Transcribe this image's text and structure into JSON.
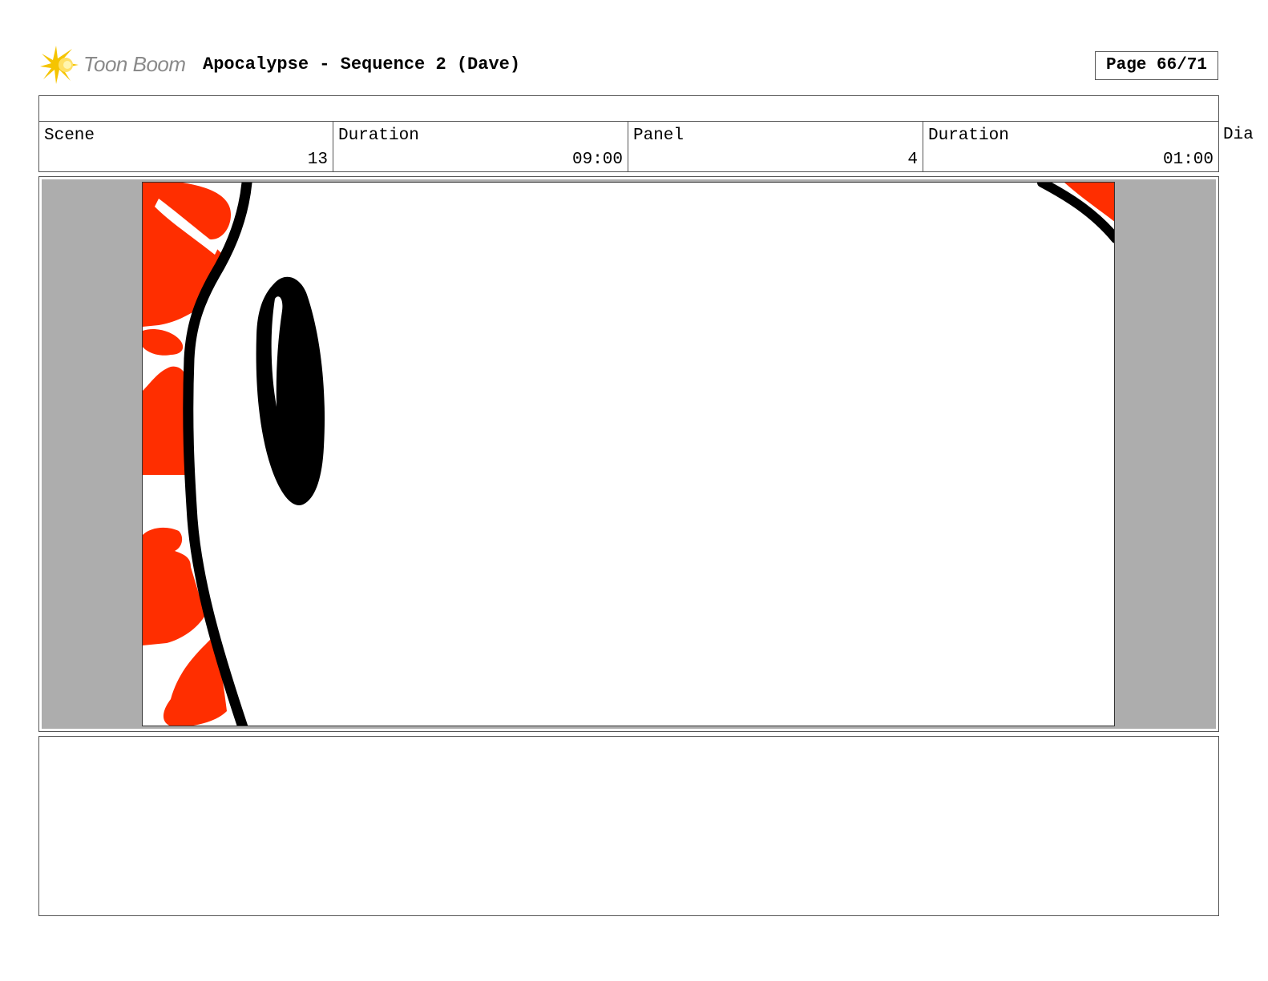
{
  "header": {
    "logo_text": "Toon Boom",
    "title": "Apocalypse - Sequence 2 (Dave)",
    "page": "Page 66/71"
  },
  "info": {
    "scene_label": "Scene",
    "scene_value": "13",
    "scene_duration_label": "Duration",
    "scene_duration_value": "09:00",
    "panel_label": "Panel",
    "panel_value": "4",
    "panel_duration_label": "Duration",
    "panel_duration_value": "01:00",
    "dialog_label": "Dia"
  },
  "colors": {
    "accent_red": "#ff2e00",
    "logo_yellow": "#f5c400",
    "frame_gray": "#adadad"
  },
  "icons": {
    "logo": "starburst-icon"
  }
}
